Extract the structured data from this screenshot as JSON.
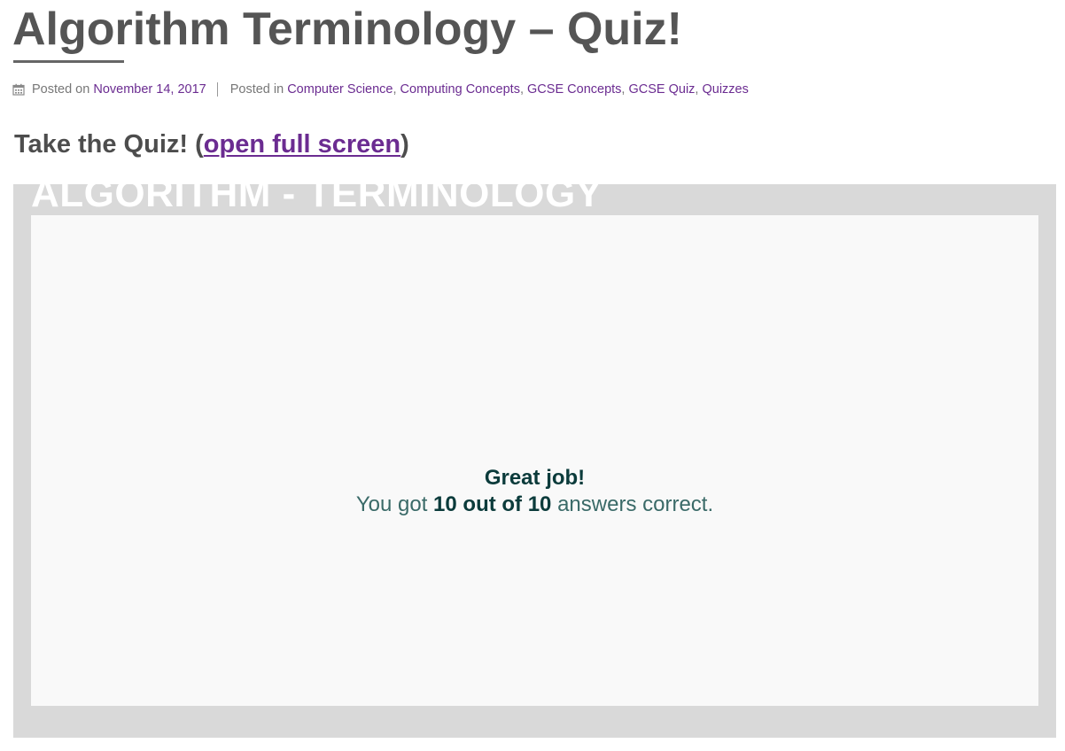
{
  "post": {
    "title": "Algorithm Terminology – Quiz!",
    "meta": {
      "posted_on_label": "Posted on",
      "date": "November 14, 2017",
      "posted_in_label": "Posted in",
      "categories": [
        "Computer Science",
        "Computing Concepts",
        "GCSE Concepts",
        "GCSE Quiz",
        "Quizzes"
      ],
      "separator": ","
    }
  },
  "quiz_section": {
    "heading_prefix": "Take the Quiz! (",
    "link_text": "open full screen",
    "heading_suffix": ")"
  },
  "quiz_embed": {
    "title": "ALGORITHM - TERMINOLOGY",
    "result": {
      "heading": "Great job!",
      "prefix": "You got",
      "score": "10 out of 10",
      "suffix": "answers correct."
    }
  },
  "colors": {
    "link": "#6b2c91",
    "title_text": "#555555",
    "frame_bg": "#d9d9d9",
    "panel_bg": "#f9f9f9",
    "result_dark": "#0b3b3b",
    "result_text": "#3a6a68"
  },
  "icons": {
    "meta_date": "calendar-icon"
  }
}
